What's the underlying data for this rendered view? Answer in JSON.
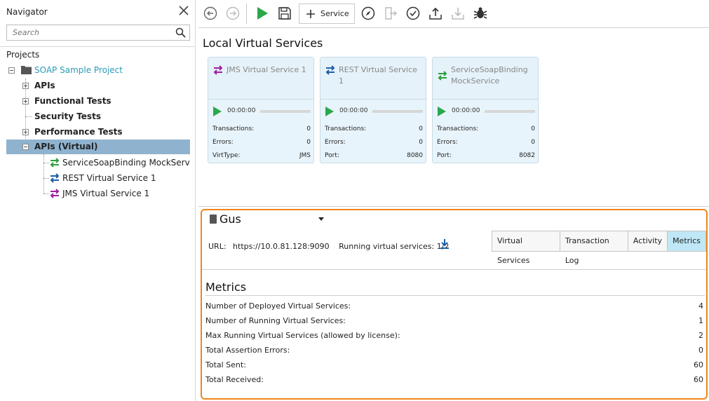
{
  "navigator": {
    "title": "Navigator",
    "search_placeholder": "Search",
    "projects_label": "Projects",
    "project_name": "SOAP Sample Project",
    "items": [
      {
        "label": "APIs",
        "expander": "plus"
      },
      {
        "label": "Functional Tests",
        "expander": "plus"
      },
      {
        "label": "Security Tests",
        "expander": "none"
      },
      {
        "label": "Performance Tests",
        "expander": "plus"
      },
      {
        "label": "APIs (Virtual)",
        "expander": "minus",
        "selected": true
      }
    ],
    "virtual_children": [
      {
        "label": "ServiceSoapBinding MockService",
        "icon": "green-arrows-icon"
      },
      {
        "label": "REST Virtual Service 1",
        "icon": "blue-arrows-icon"
      },
      {
        "label": "JMS Virtual Service 1",
        "icon": "purple-arrows-icon"
      }
    ]
  },
  "toolbar": {
    "service_label": "Service"
  },
  "local_virtual_services": {
    "title": "Local Virtual Services",
    "cards": [
      {
        "name": "JMS Virtual Service 1",
        "time": "00:00:00",
        "transactions_label": "Transactions:",
        "transactions": "0",
        "errors_label": "Errors:",
        "errors": "0",
        "extra_label": "VirtType:",
        "extra_value": "JMS",
        "icon_color": "#a020a0"
      },
      {
        "name": "REST Virtual Service 1",
        "time": "00:00:00",
        "transactions_label": "Transactions:",
        "transactions": "0",
        "errors_label": "Errors:",
        "errors": "0",
        "extra_label": "Port:",
        "extra_value": "8080",
        "icon_color": "#1f5fa8"
      },
      {
        "name": "ServiceSoapBinding MockService",
        "time": "00:00:00",
        "transactions_label": "Transactions:",
        "transactions": "0",
        "errors_label": "Errors:",
        "errors": "0",
        "extra_label": "Port:",
        "extra_value": "8082",
        "icon_color": "#2e9e3e"
      }
    ]
  },
  "server": {
    "name": "Gus",
    "url_label": "URL:",
    "url": "https://10.0.81.128:9090",
    "running_label": "Running virtual services: 1/2",
    "tabs": [
      "Virtual Services",
      "Transaction Log",
      "Activity",
      "Metrics"
    ],
    "active_tab": "Metrics"
  },
  "metrics": {
    "title": "Metrics",
    "rows": [
      {
        "label": "Number of Deployed Virtual Services:",
        "value": "4"
      },
      {
        "label": "Number of Running Virtual Services:",
        "value": "1"
      },
      {
        "label": "Max Running Virtual Services (allowed by license):",
        "value": "2"
      },
      {
        "label": "Total Assertion Errors:",
        "value": "0"
      },
      {
        "label": "Total Sent:",
        "value": "60"
      },
      {
        "label": "Total Received:",
        "value": "60"
      }
    ]
  },
  "colors": {
    "accent_orange": "#f0851c",
    "play_green": "#2aa84a",
    "active_tab": "#bfe7f6",
    "selected_row": "#8fb3cf",
    "project_teal": "#2a9bb5"
  }
}
